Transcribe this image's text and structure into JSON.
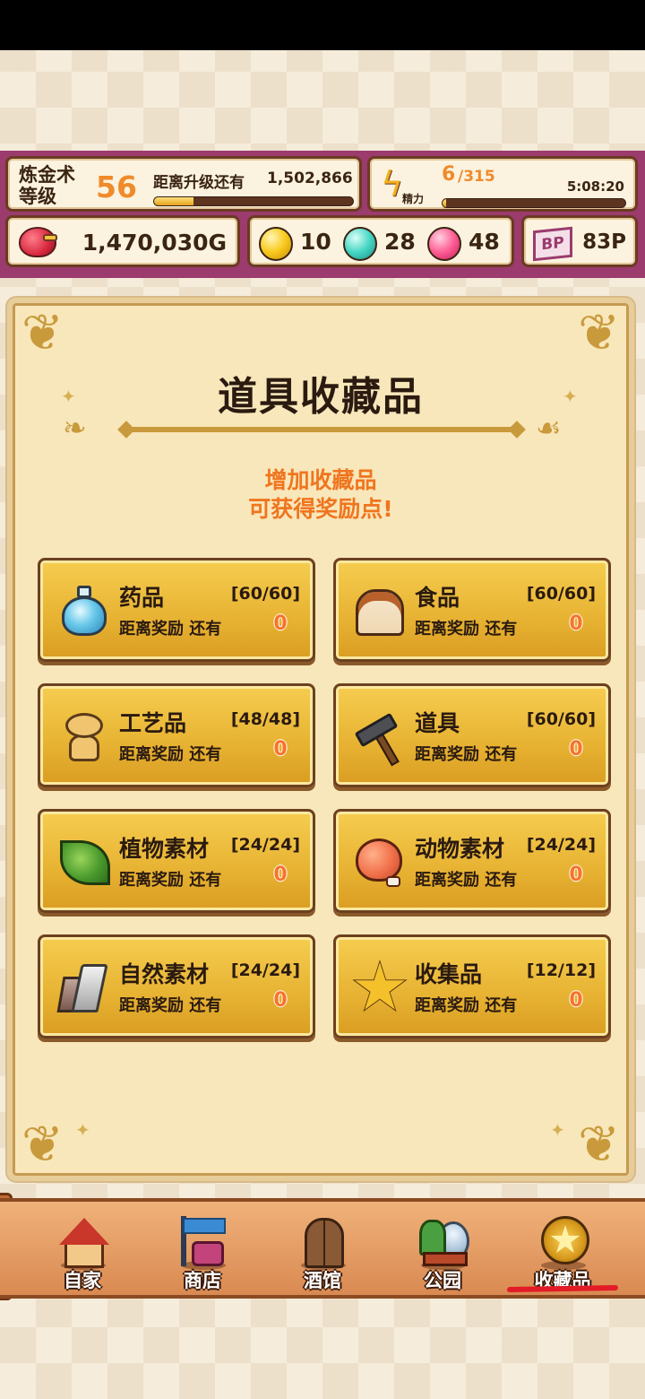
{
  "hud": {
    "level_label": "炼金术\n等级",
    "level_value": "56",
    "next_level_label": "距离升级还有",
    "next_level_value": "1,502,866",
    "level_progress": 0.2,
    "stamina_label": "精力",
    "stamina_value": "6",
    "stamina_max": "/315",
    "stamina_timer": "5:08:20",
    "stamina_progress": 0.02,
    "gold_value": "1,470,030G",
    "gem_yellow": "10",
    "gem_cyan": "28",
    "gem_pink": "48",
    "bp_icon": "BP",
    "bp_value": "83P"
  },
  "panel": {
    "title": "道具收藏品",
    "subtitle_line1": "增加收藏品",
    "subtitle_line2": "可获得奖励点!"
  },
  "categories": [
    {
      "name": "药品",
      "count": "[60/60]",
      "sub": "距离奖励 还有",
      "reward": "0",
      "icon": "potion-icon"
    },
    {
      "name": "食品",
      "count": "[60/60]",
      "sub": "距离奖励 还有",
      "reward": "0",
      "icon": "bread-icon"
    },
    {
      "name": "工艺品",
      "count": "[48/48]",
      "sub": "距离奖励 还有",
      "reward": "0",
      "icon": "bear-figurine-icon"
    },
    {
      "name": "道具",
      "count": "[60/60]",
      "sub": "距离奖励 还有",
      "reward": "0",
      "icon": "hammer-icon"
    },
    {
      "name": "植物素材",
      "count": "[24/24]",
      "sub": "距离奖励 还有",
      "reward": "0",
      "icon": "leaf-icon"
    },
    {
      "name": "动物素材",
      "count": "[24/24]",
      "sub": "距离奖励 还有",
      "reward": "0",
      "icon": "meat-icon"
    },
    {
      "name": "自然素材",
      "count": "[24/24]",
      "sub": "距离奖励 还有",
      "reward": "0",
      "icon": "rock-icon"
    },
    {
      "name": "收集品",
      "count": "[12/12]",
      "sub": "距离奖励 还有",
      "reward": "0",
      "icon": "star-icon"
    }
  ],
  "nav": {
    "items": [
      {
        "label": "自家",
        "icon": "house-icon"
      },
      {
        "label": "商店",
        "icon": "shop-icon"
      },
      {
        "label": "酒馆",
        "icon": "tavern-icon"
      },
      {
        "label": "公园",
        "icon": "park-icon"
      },
      {
        "label": "收藏品",
        "icon": "collection-medal-icon",
        "active": true
      }
    ]
  },
  "colors": {
    "hud_bg": "#9b3b6e",
    "accent_orange": "#f0751f",
    "card_gold": "#e7b232",
    "active_underline": "#e21b26"
  }
}
